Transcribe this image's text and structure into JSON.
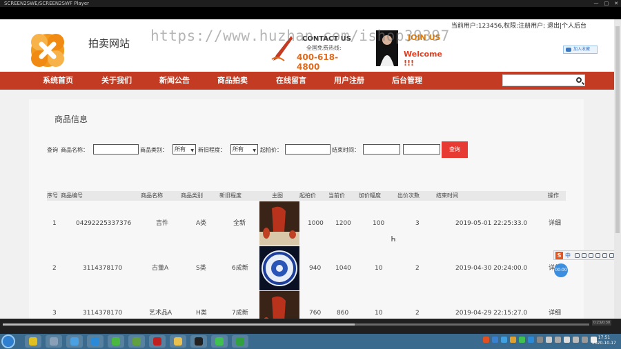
{
  "window": {
    "title": "SCREEN2SWE/SCREEN2SWF Player",
    "controls": [
      "—",
      "□",
      "✕"
    ]
  },
  "header": {
    "site_name": "拍卖网站",
    "watermark": "https://www.huzhan.com/ishop39397",
    "contact": {
      "title": "CONTACT US",
      "subtitle": "全国免费热线:",
      "phone": "400-618-4800"
    },
    "welcome": {
      "title": "JOIN US",
      "subtitle": "Welcome !!!"
    },
    "userbar": "当前用户:123456,权限:注册用户; 退出|个人后台",
    "share_label": "加入收藏"
  },
  "nav": {
    "items": [
      "系统首页",
      "关于我们",
      "新闻公告",
      "商品拍卖",
      "在线留言",
      "用户注册",
      "后台管理"
    ],
    "search_placeholder": ""
  },
  "panel": {
    "title": "商品信息",
    "filter": {
      "query_label": "查询",
      "name_label": "商品名称：",
      "category_label": "商品类别：",
      "category_value": "所有",
      "condition_label": "新旧程度：",
      "condition_value": "所有",
      "start_price_label": "起拍价：",
      "end_time_label": "结束时间：",
      "search_button": "查询"
    },
    "table": {
      "headers": [
        "序号",
        "商品编号",
        "商品名称",
        "商品类别",
        "新旧程度",
        "主图",
        "起拍价",
        "当前价",
        "加价幅度",
        "出价次数",
        "结束时间",
        "操作"
      ],
      "rows": [
        {
          "index": "1",
          "code": "04292225337376",
          "name": "吉件",
          "category": "A类",
          "condition": "全新",
          "start_price": "1000",
          "current_price": "1200",
          "increment": "100",
          "bids": "3",
          "end_time": "2019-05-01 22:25:33.0",
          "action": "详细"
        },
        {
          "index": "2",
          "code": "3114378170",
          "name": "古董A",
          "category": "S类",
          "condition": "6成新",
          "start_price": "940",
          "current_price": "1040",
          "increment": "10",
          "bids": "2",
          "end_time": "2019-04-30 20:24:00.0",
          "action": "详细"
        },
        {
          "index": "3",
          "code": "3114378170",
          "name": "艺术品A",
          "category": "H类",
          "condition": "7成新",
          "start_price": "760",
          "current_price": "860",
          "increment": "10",
          "bids": "2",
          "end_time": "2019-04-29 22:15:27.0",
          "action": "详细"
        }
      ]
    }
  },
  "ime": {
    "logo": "S",
    "mode": "中"
  },
  "float_badge": "00:00",
  "player": {
    "time": "0:23/0:30",
    "progress": 0.6
  },
  "taskbar": {
    "time": "17:51",
    "date": "2020-10-17"
  },
  "colors": {
    "nav_bg": "#c23b22",
    "search_button": "#e73a33",
    "phone": "#e06a1a"
  }
}
